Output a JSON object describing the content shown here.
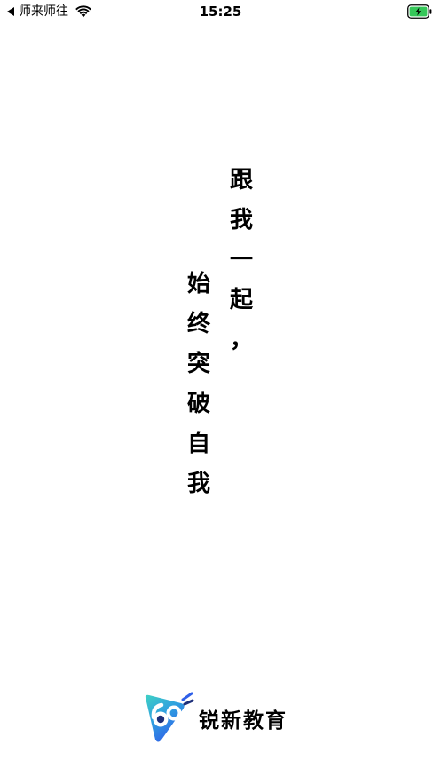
{
  "status_bar": {
    "back_app": "师来师往",
    "time": "15:25",
    "battery_color": "#35c759"
  },
  "slogan": {
    "line1": [
      "跟",
      "我",
      "一",
      "起",
      "，"
    ],
    "line2": [
      "始",
      "终",
      "突",
      "破",
      "自",
      "我"
    ]
  },
  "brand": {
    "name": "锐新教育",
    "logo_icon": "ruixin-logo-icon",
    "colors": {
      "teal": "#3fd1c4",
      "blue": "#2f5fe8",
      "navy": "#1d2f7a"
    }
  }
}
